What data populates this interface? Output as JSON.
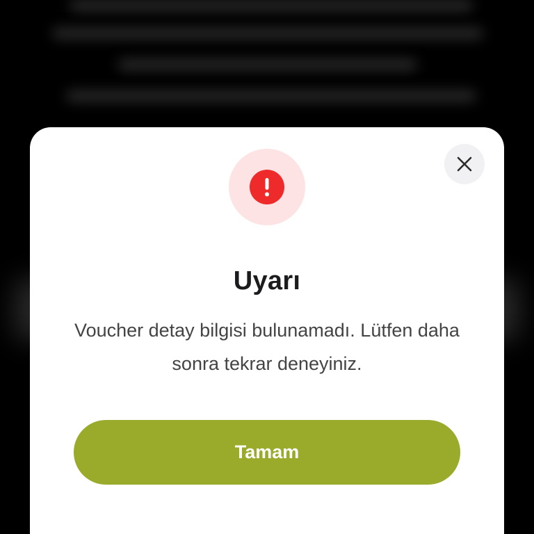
{
  "modal": {
    "title": "Uyarı",
    "message": "Voucher detay bilgisi bulunamadı. Lütfen daha sonra tekrar deneyiniz.",
    "primary_button_label": "Tamam",
    "alert_icon": "exclamation-circle-icon",
    "close_icon": "close-icon"
  },
  "colors": {
    "backdrop": "#000000",
    "sheet_background": "#ffffff",
    "alert_red": "#ee2a2a",
    "alert_halo": "#fde3e3",
    "primary_button": "#9aaa2a",
    "close_button_bg": "#f1f1f3"
  }
}
